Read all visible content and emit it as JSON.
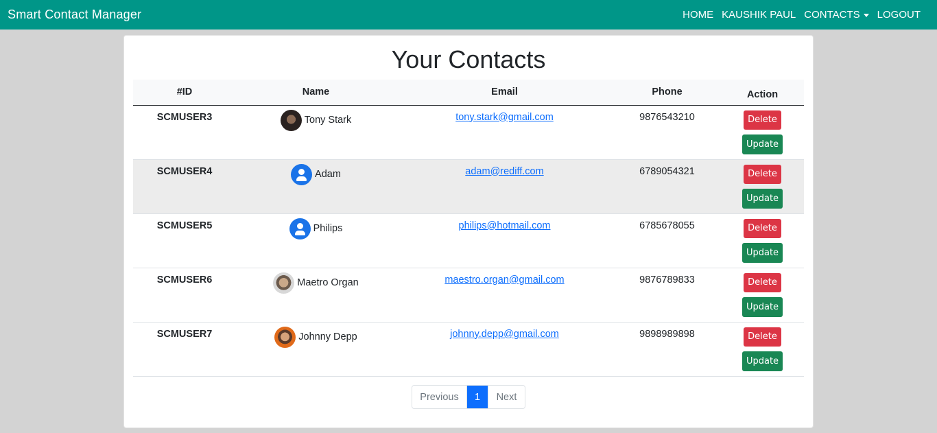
{
  "navbar": {
    "brand": "Smart Contact Manager",
    "links": {
      "home": "HOME",
      "user": "KAUSHIK PAUL",
      "contacts": "CONTACTS",
      "logout": "LOGOUT"
    },
    "bg_color": "#009688"
  },
  "page": {
    "title": "Your Contacts"
  },
  "table": {
    "headers": [
      "#ID",
      "Name",
      "Email",
      "Phone",
      "Action"
    ],
    "rows": [
      {
        "id": "SCMUSER3",
        "name": "Tony Stark",
        "email": "tony.stark@gmail.com",
        "phone": "9876543210",
        "avatar": "photo"
      },
      {
        "id": "SCMUSER4",
        "name": "Adam",
        "email": "adam@rediff.com",
        "phone": "6789054321",
        "avatar": "default-user-icon"
      },
      {
        "id": "SCMUSER5",
        "name": "Philips",
        "email": "philips@hotmail.com",
        "phone": "6785678055",
        "avatar": "default-user-icon"
      },
      {
        "id": "SCMUSER6",
        "name": "Maetro Organ",
        "email": "maestro.organ@gmail.com",
        "phone": "9876789833",
        "avatar": "photo"
      },
      {
        "id": "SCMUSER7",
        "name": "Johnny Depp",
        "email": "johnny.depp@gmail.com",
        "phone": "9898989898",
        "avatar": "photo"
      }
    ],
    "actions": {
      "delete": "Delete",
      "update": "Update"
    },
    "colors": {
      "delete": "#dc3545",
      "update": "#198754"
    }
  },
  "pagination": {
    "previous": "Previous",
    "current": "1",
    "next": "Next",
    "active_color": "#0d6efd"
  }
}
